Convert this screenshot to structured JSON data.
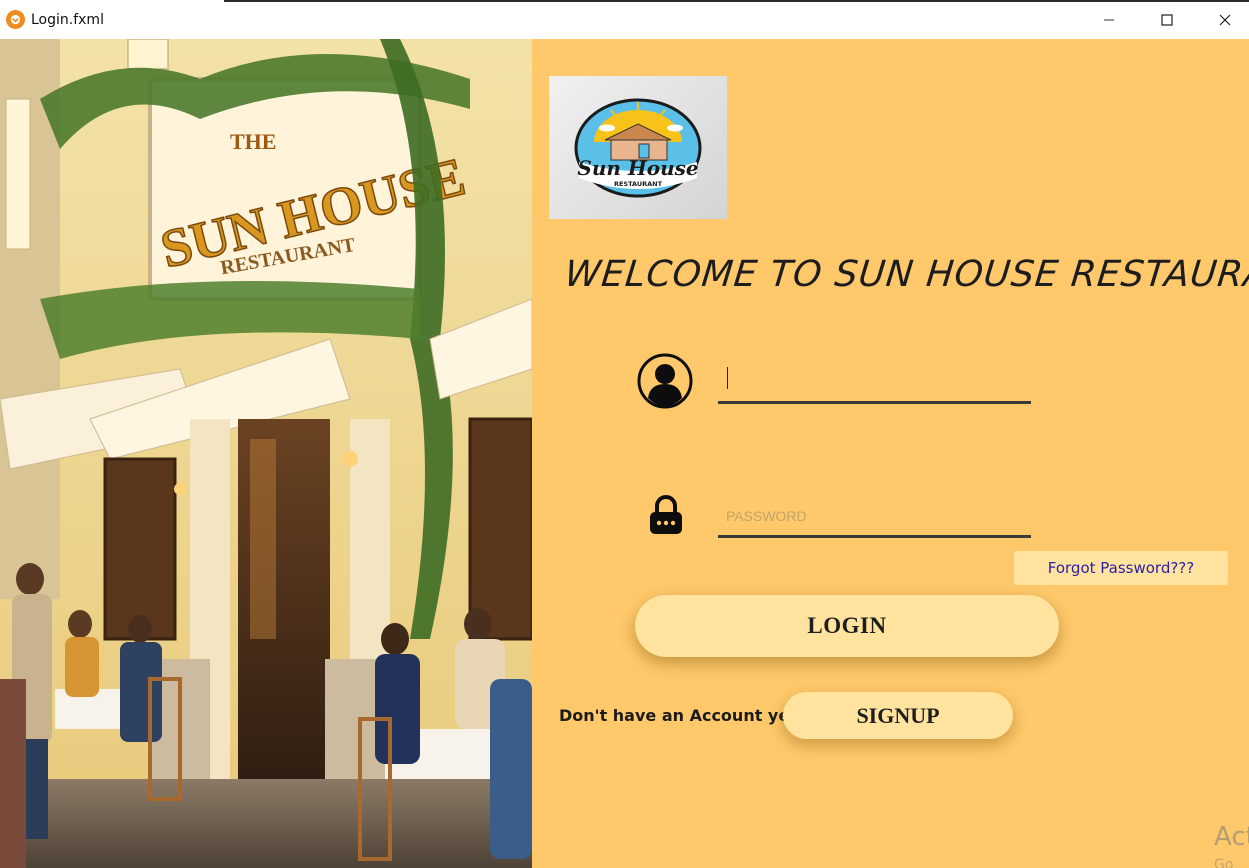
{
  "window": {
    "title": "Login.fxml",
    "icon": "app-icon"
  },
  "logo": {
    "brand": "Sun House",
    "sub": "RESTAURANT"
  },
  "photo": {
    "sign_top": "THE",
    "sign_main": "SUN HOUSE",
    "sign_sub": "RESTAURANT"
  },
  "form": {
    "welcome": "WELCOME TO SUN HOUSE RESTAURANT",
    "username": {
      "value": "",
      "placeholder": "",
      "icon": "user-icon"
    },
    "password": {
      "value": "",
      "placeholder": "PASSWORD",
      "icon": "lock-icon"
    },
    "forgot_label": "Forgot Password???",
    "login_label": "LOGIN",
    "no_account_text": "Don't have an Account yet?",
    "signup_label": "SIGNUP"
  },
  "watermark": {
    "line1": "Act",
    "line2": "Go"
  },
  "colors": {
    "panel_bg": "#ffc96b",
    "button_bg": "#ffe39e",
    "link": "#2b1fa8"
  }
}
